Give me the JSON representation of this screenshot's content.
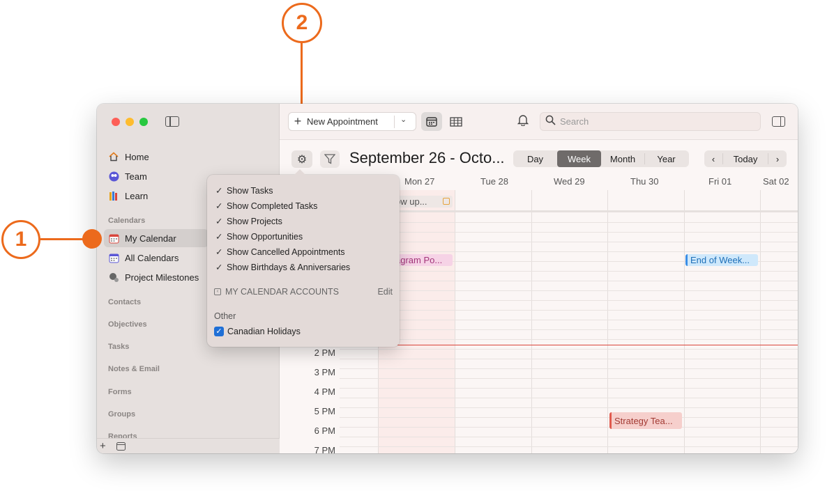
{
  "callouts": {
    "one": "1",
    "two": "2"
  },
  "sidebar": {
    "items": [
      {
        "label": "Home",
        "icon": "house-icon"
      },
      {
        "label": "Team",
        "icon": "team-icon"
      },
      {
        "label": "Learn",
        "icon": "books-icon"
      }
    ],
    "calendars_label": "Calendars",
    "calendars": [
      {
        "label": "My Calendar",
        "icon": "calendar-icon",
        "active": true
      },
      {
        "label": "All Calendars",
        "icon": "calendar-icon"
      },
      {
        "label": "Project Milestones",
        "icon": "milestone-icon"
      }
    ],
    "sections": [
      "Contacts",
      "Objectives",
      "Tasks",
      "Notes & Email",
      "Forms",
      "Groups",
      "Reports"
    ]
  },
  "toolbar": {
    "new_appointment": "New Appointment",
    "search_placeholder": "Search"
  },
  "header": {
    "date_range": "September 26 - Octo...",
    "views": [
      "Day",
      "Week",
      "Month",
      "Year"
    ],
    "active_view": "Week",
    "today": "Today"
  },
  "calendar": {
    "days": [
      "Mon 27",
      "Tue 28",
      "Wed 29",
      "Thu 30",
      "Fri 01",
      "Sat 02"
    ],
    "times": [
      "2 PM",
      "3 PM",
      "4 PM",
      "5 PM",
      "6 PM",
      "7 PM"
    ],
    "events": {
      "follow": "ow up...",
      "instagram": "agram Po...",
      "end_of_week": "End of Week...",
      "strategy": "Strategy Tea..."
    }
  },
  "popover": {
    "options": [
      "Show Tasks",
      "Show Completed Tasks",
      "Show Projects",
      "Show Opportunities",
      "Show Cancelled Appointments",
      "Show Birthdays & Anniversaries"
    ],
    "accounts_label": "MY CALENDAR ACCOUNTS",
    "edit": "Edit",
    "other": "Other",
    "holiday": "Canadian Holidays"
  },
  "colors": {
    "accent": "#ec6a1c",
    "sidebar_bg": "#e6e0de",
    "active_view": "#6f6b6a"
  }
}
